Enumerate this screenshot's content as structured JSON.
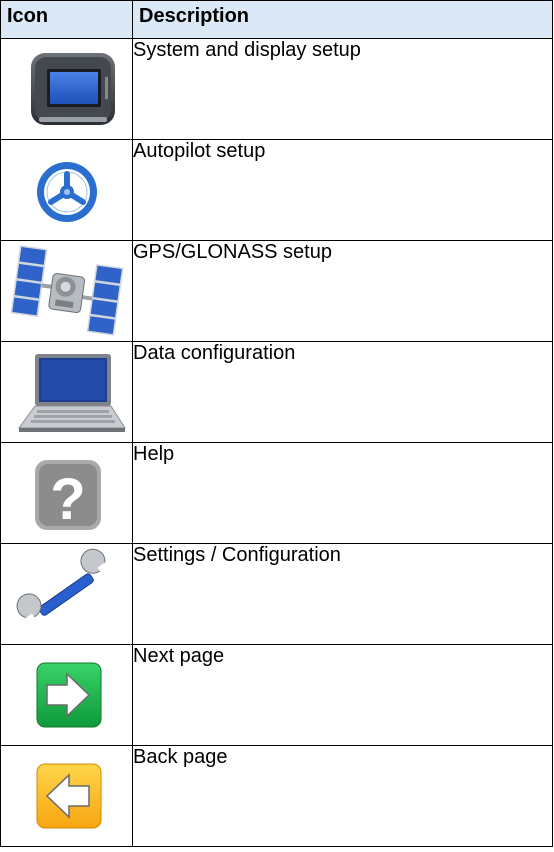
{
  "table": {
    "headers": {
      "icon": "Icon",
      "description": "Description"
    },
    "rows": [
      {
        "icon": "display-unit-icon",
        "description": "System and display setup"
      },
      {
        "icon": "steering-wheel-icon",
        "description": "Autopilot setup"
      },
      {
        "icon": "satellite-icon",
        "description": "GPS/GLONASS setup"
      },
      {
        "icon": "laptop-icon",
        "description": "Data configuration"
      },
      {
        "icon": "help-question-icon",
        "description": "Help"
      },
      {
        "icon": "wrench-icon",
        "description": "Settings / Configuration"
      },
      {
        "icon": "next-arrow-icon",
        "description": "Next page"
      },
      {
        "icon": "back-arrow-icon",
        "description": "Back page"
      }
    ]
  }
}
